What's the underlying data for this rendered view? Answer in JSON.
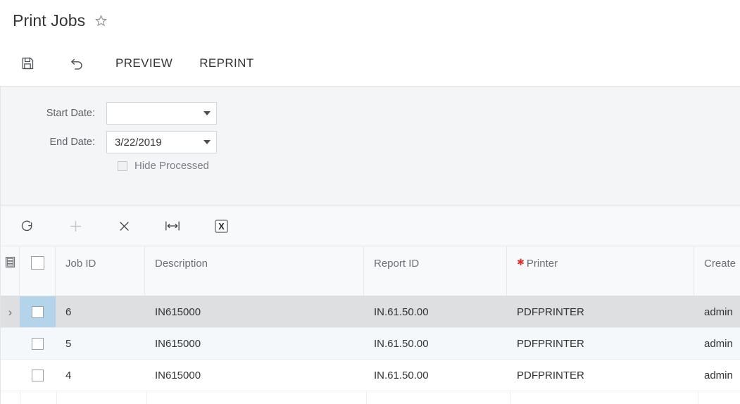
{
  "page": {
    "title": "Print Jobs",
    "favorite_icon": "star-outline-icon"
  },
  "action_bar": {
    "save_icon": "save-floppy-icon",
    "undo_icon": "undo-arrow-icon",
    "preview_label": "PREVIEW",
    "reprint_label": "REPRINT"
  },
  "filters": {
    "start_date": {
      "label": "Start Date:",
      "value": "",
      "placeholder": ""
    },
    "end_date": {
      "label": "End Date:",
      "value": "3/22/2019",
      "placeholder": ""
    },
    "hide_processed": {
      "label": "Hide Processed",
      "checked": false,
      "disabled": true
    }
  },
  "grid_toolbar": {
    "buttons": [
      {
        "name": "refresh-icon",
        "label": "Refresh",
        "disabled": false
      },
      {
        "name": "add-plus-icon",
        "label": "Add",
        "disabled": true
      },
      {
        "name": "delete-x-icon",
        "label": "Delete",
        "disabled": false
      },
      {
        "name": "fit-columns-icon",
        "label": "Fit Columns",
        "disabled": false
      },
      {
        "name": "export-excel-icon",
        "label": "Export to Excel",
        "disabled": false
      }
    ]
  },
  "grid": {
    "settings_icon": "grid-settings-icon",
    "columns": [
      {
        "key": "job_id",
        "label": "Job ID",
        "required": false
      },
      {
        "key": "description",
        "label": "Description",
        "required": false
      },
      {
        "key": "report_id",
        "label": "Report ID",
        "required": false
      },
      {
        "key": "printer",
        "label": "Printer",
        "required": true
      },
      {
        "key": "created",
        "label": "Create",
        "required": false
      }
    ],
    "rows": [
      {
        "job_id": "6",
        "description": "IN615000",
        "report_id": "IN.61.50.00",
        "printer": "PDFPRINTER",
        "created": "admin",
        "selected": true,
        "checked": false
      },
      {
        "job_id": "5",
        "description": "IN615000",
        "report_id": "IN.61.50.00",
        "printer": "PDFPRINTER",
        "created": "admin",
        "selected": false,
        "checked": false
      },
      {
        "job_id": "4",
        "description": "IN615000",
        "report_id": "IN.61.50.00",
        "printer": "PDFPRINTER",
        "created": "admin",
        "selected": false,
        "checked": false
      }
    ]
  },
  "colors": {
    "accent_selected_row": "#dddfe1",
    "accent_checkbox_cell": "#b3d4ea",
    "panel_background": "#f4f5f7",
    "required_marker": "#e03030",
    "text_primary": "#333333",
    "text_muted": "#6b7076"
  }
}
